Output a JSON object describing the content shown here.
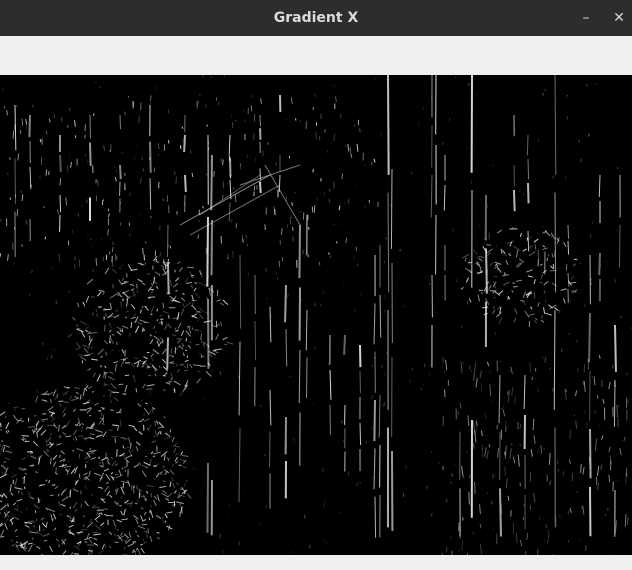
{
  "window": {
    "title": "Gradient X",
    "minimize_glyph": "–",
    "close_glyph": "✕"
  },
  "image": {
    "description_name": "sobel-gradient-x-image"
  },
  "colors": {
    "titlebar": "#2d2d2d",
    "window_bg": "#efefef",
    "image_bg": "#000000",
    "edge": "#e8e8e8"
  }
}
